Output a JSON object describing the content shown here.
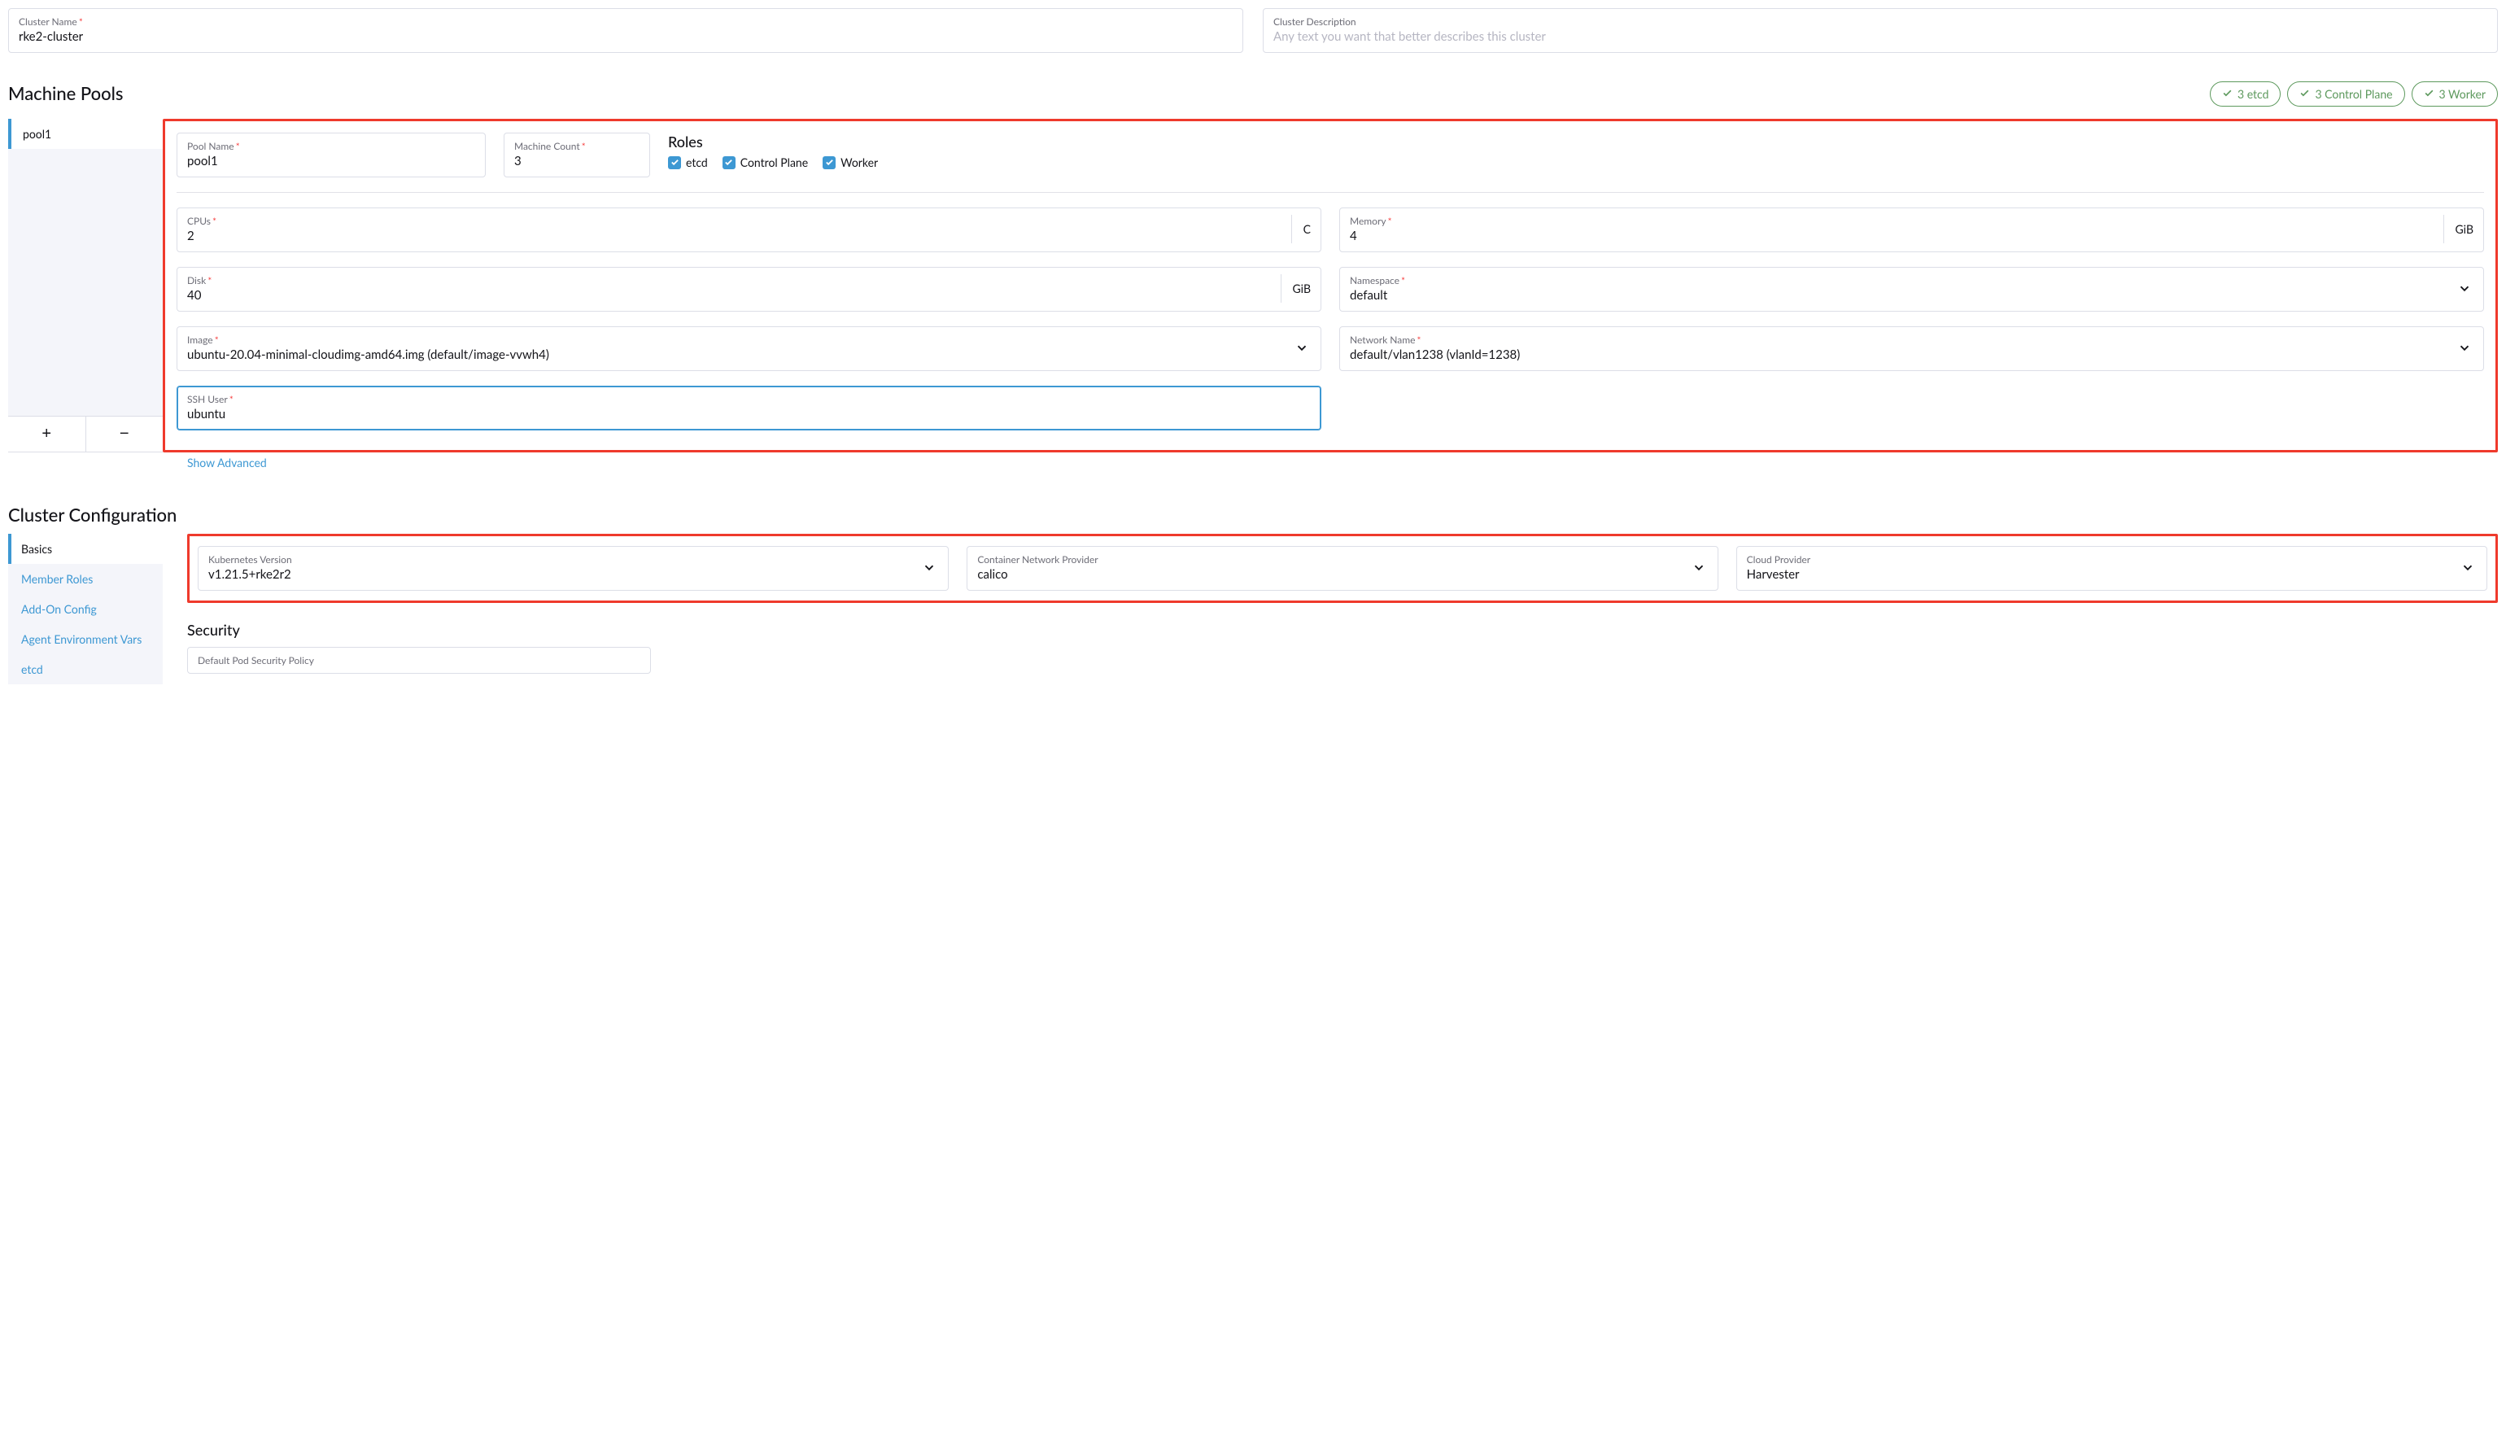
{
  "top": {
    "clusterNameLabel": "Cluster Name",
    "clusterNameValue": "rke2-cluster",
    "clusterDescLabel": "Cluster Description",
    "clusterDescPlaceholder": "Any text you want that better describes this cluster"
  },
  "machinePoolsHeading": "Machine Pools",
  "badges": {
    "etcd": "3 etcd",
    "cp": "3 Control Plane",
    "worker": "3 Worker"
  },
  "poolTabs": {
    "pool1": "pool1"
  },
  "pool": {
    "poolNameLabel": "Pool Name",
    "poolNameValue": "pool1",
    "machineCountLabel": "Machine Count",
    "machineCountValue": "3",
    "rolesHeading": "Roles",
    "roleEtcd": "etcd",
    "roleCP": "Control Plane",
    "roleWorker": "Worker",
    "cpusLabel": "CPUs",
    "cpusValue": "2",
    "cpusUnit": "C",
    "memLabel": "Memory",
    "memValue": "4",
    "memUnit": "GiB",
    "diskLabel": "Disk",
    "diskValue": "40",
    "diskUnit": "GiB",
    "nsLabel": "Namespace",
    "nsValue": "default",
    "imgLabel": "Image",
    "imgValue": "ubuntu-20.04-minimal-cloudimg-amd64.img (default/image-vvwh4)",
    "netLabel": "Network Name",
    "netValue": "default/vlan1238 (vlanId=1238)",
    "sshLabel": "SSH User",
    "sshValue": "ubuntu",
    "showAdvanced": "Show Advanced"
  },
  "clusterConfigHeading": "Cluster Configuration",
  "configTabs": {
    "basics": "Basics",
    "memberRoles": "Member Roles",
    "addOn": "Add-On Config",
    "agentEnv": "Agent Environment Vars",
    "etcd": "etcd"
  },
  "basics": {
    "k8sLabel": "Kubernetes Version",
    "k8sValue": "v1.21.5+rke2r2",
    "cniLabel": "Container Network Provider",
    "cniValue": "calico",
    "cloudLabel": "Cloud Provider",
    "cloudValue": "Harvester"
  },
  "securityHeading": "Security",
  "securityFieldLabel": "Default Pod Security Policy"
}
